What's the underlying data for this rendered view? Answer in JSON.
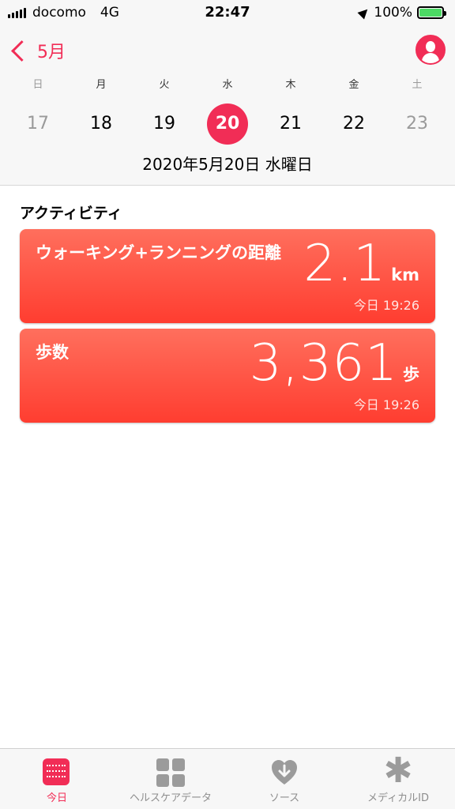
{
  "status": {
    "carrier": "docomo",
    "network": "4G",
    "time": "22:47",
    "battery": "100%"
  },
  "nav": {
    "back_label": "5月"
  },
  "week": {
    "days_of_week": [
      "日",
      "月",
      "火",
      "水",
      "木",
      "金",
      "土"
    ],
    "dates": [
      "17",
      "18",
      "19",
      "20",
      "21",
      "22",
      "23"
    ],
    "selected_index": 3,
    "date_label": "2020年5月20日 水曜日"
  },
  "activity": {
    "section_title": "アクティビティ",
    "cards": [
      {
        "title": "ウォーキング+ランニングの距離",
        "value": "2.1",
        "unit": "km",
        "timestamp": "今日 19:26"
      },
      {
        "title": "歩数",
        "value": "3,361",
        "unit": "歩",
        "timestamp": "今日 19:26"
      }
    ]
  },
  "tabs": [
    {
      "label": "今日",
      "icon": "calendar-icon",
      "active": true
    },
    {
      "label": "ヘルスケアデータ",
      "icon": "grid-icon",
      "active": false
    },
    {
      "label": "ソース",
      "icon": "heart-download-icon",
      "active": false
    },
    {
      "label": "メディカルID",
      "icon": "asterisk-icon",
      "active": false
    }
  ],
  "colors": {
    "accent": "#f12d56",
    "card_gradient_top": "#ff6f5d",
    "card_gradient_bottom": "#ff3d30",
    "battery": "#4cd964"
  }
}
